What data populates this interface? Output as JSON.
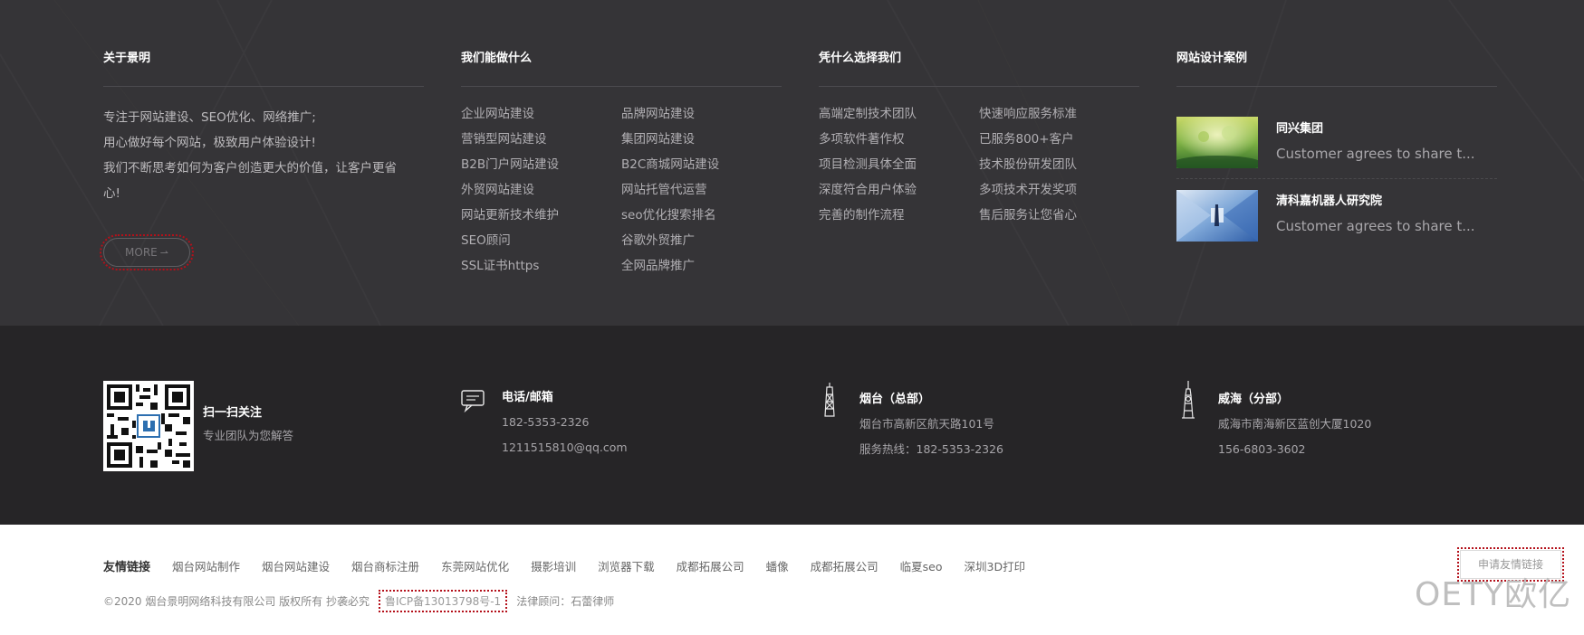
{
  "about": {
    "title": "关于景明",
    "lines": [
      "专注于网站建设、SEO优化、网络推广;",
      "用心做好每个网站，极致用户体验设计!",
      "我们不断思考如何为客户创造更大的价值，让客户更省",
      "心!"
    ],
    "more_label": "MORE",
    "more_arrow": "⇀"
  },
  "services": {
    "title": "我们能做什么",
    "items": [
      "企业网站建设",
      "品牌网站建设",
      "营销型网站建设",
      "集团网站建设",
      "B2B门户网站建设",
      "B2C商城网站建设",
      "外贸网站建设",
      "网站托管代运营",
      "网站更新技术维护",
      "seo优化搜索排名",
      "SEO顾问",
      "谷歌外贸推广",
      "SSL证书https",
      "全网品牌推广"
    ]
  },
  "why": {
    "title": "凭什么选择我们",
    "items": [
      "高端定制技术团队",
      "快速响应服务标准",
      "多项软件著作权",
      "已服务800+客户",
      "项目检测具体全面",
      "技术股份研发团队",
      "深度符合用户体验",
      "多项技术开发奖项",
      "完善的制作流程",
      "售后服务让您省心"
    ]
  },
  "cases": {
    "title": "网站设计案例",
    "items": [
      {
        "name": "同兴集团",
        "desc": "Customer agrees to share t..."
      },
      {
        "name": "清科嘉机器人研究院",
        "desc": "Customer agrees to share t..."
      }
    ]
  },
  "contact": {
    "qr_title": "扫一扫关注",
    "qr_sub": "专业团队为您解答",
    "phone_title": "电话/邮箱",
    "phone": "182-5353-2326",
    "email": "1211515810@qq.com",
    "hq_title": "烟台（总部）",
    "hq_address": "烟台市高新区航天路101号",
    "hq_hotline": "服务热线：182-5353-2326",
    "branch_title": "威海（分部）",
    "branch_address": "威海市南海新区蓝创大厦1020",
    "branch_phone": "156-6803-3602"
  },
  "footer": {
    "friend_label": "友情链接",
    "friend_links": [
      "烟台网站制作",
      "烟台网站建设",
      "烟台商标注册",
      "东莞网站优化",
      "摄影培训",
      "浏览器下载",
      "成都拓展公司",
      "蟠像",
      "成都拓展公司",
      "临夏seo",
      "深圳3D打印"
    ],
    "apply_label": "申请友情链接",
    "copyright": "©2020 烟台景明网络科技有限公司 版权所有 抄袭必究",
    "icp": "鲁ICP备13013798号-1",
    "lawyer": "法律顾问：石蕾律师",
    "watermark": "OETY欧亿"
  },
  "colors": {
    "top_bg": "#353437",
    "mid_bg": "#262527",
    "accent_outline": "#b4101a"
  }
}
